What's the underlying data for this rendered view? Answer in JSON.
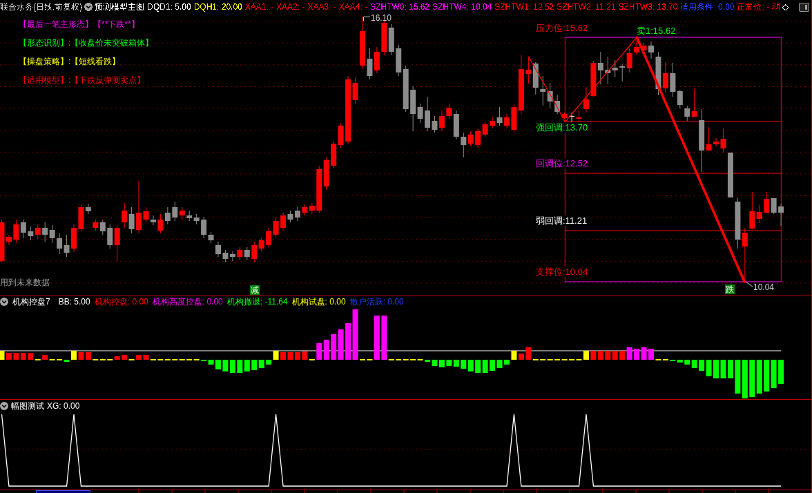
{
  "header": {
    "title": "联合水务(日线,前复权)",
    "formula": "预测模型主图",
    "values": [
      {
        "text": "DQD1: 5.00",
        "color": "#ffffff"
      },
      {
        "text": "DQH1: 20.00",
        "color": "#ffff00"
      },
      {
        "text": "XAA1: -",
        "color": "#ff0000"
      },
      {
        "text": "XAA2: -",
        "color": "#ff0000"
      },
      {
        "text": "XAA3: -",
        "color": "#ff0000"
      },
      {
        "text": "XAA4: -",
        "color": "#ff0000"
      },
      {
        "text": "SZHTW0: 15.62",
        "color": "#ff00ff"
      },
      {
        "text": "SZHTW4: 10.04",
        "color": "#ff00ff"
      },
      {
        "text": "SZHTW1: 12.52",
        "color": "#ff0000"
      },
      {
        "text": "SZHTW2: 11.21",
        "color": "#ff0000"
      },
      {
        "text": "SZHTW3: 13.70",
        "color": "#ff0000"
      },
      {
        "text": "适用条件: 0.00",
        "color": "#2040ff"
      },
      {
        "text": "正常位: -",
        "color": "#ff0000"
      },
      {
        "text": "弱",
        "color": "#ff0000"
      }
    ],
    "glyph": "◇"
  },
  "main_chart": {
    "annotations": [
      {
        "text": "【最后一笔主形态】【**下跌**】",
        "color": "#ff00ff"
      },
      {
        "text": "【形态识别】:【收盘价未突破箱体】",
        "color": "#00ff00"
      },
      {
        "text": "【操盘策略】:【短线看跌】",
        "color": "#ffff00"
      },
      {
        "text": "【适用模型】:【下跌反弹测卖点】",
        "color": "#ff0000"
      }
    ],
    "levels": [
      {
        "text": "压力位:15.62",
        "color": "#ff0000"
      },
      {
        "text": "强回调:13.70",
        "color": "#00ff00"
      },
      {
        "text": "回调位:12.52",
        "color": "#ff00ff"
      },
      {
        "text": "弱回调:11.21",
        "color": "#ffffff"
      },
      {
        "text": "支撑位:10.04",
        "color": "#ff0000"
      }
    ],
    "sell_point": "卖1:15.62",
    "high_label": "16.10",
    "low_label": "10.04",
    "notice": "用到未来数据",
    "signals": [
      "减",
      "跌"
    ]
  },
  "indicator_panel": {
    "title": "机构控盘7",
    "values": [
      {
        "text": "BB: 5.00",
        "color": "#ffffff"
      },
      {
        "text": "机构控盘: 0.00",
        "color": "#ff0000"
      },
      {
        "text": "机构高度控盘: 0.00",
        "color": "#ff00ff"
      },
      {
        "text": "机构撤退: -11.64",
        "color": "#00ff00"
      },
      {
        "text": "机构试盘: 0.00",
        "color": "#ffff00"
      },
      {
        "text": "散户活跃: 0.00",
        "color": "#2040ff"
      }
    ]
  },
  "sub_panel": {
    "title": "幅图测试",
    "value": "XG: 0.00"
  }
}
